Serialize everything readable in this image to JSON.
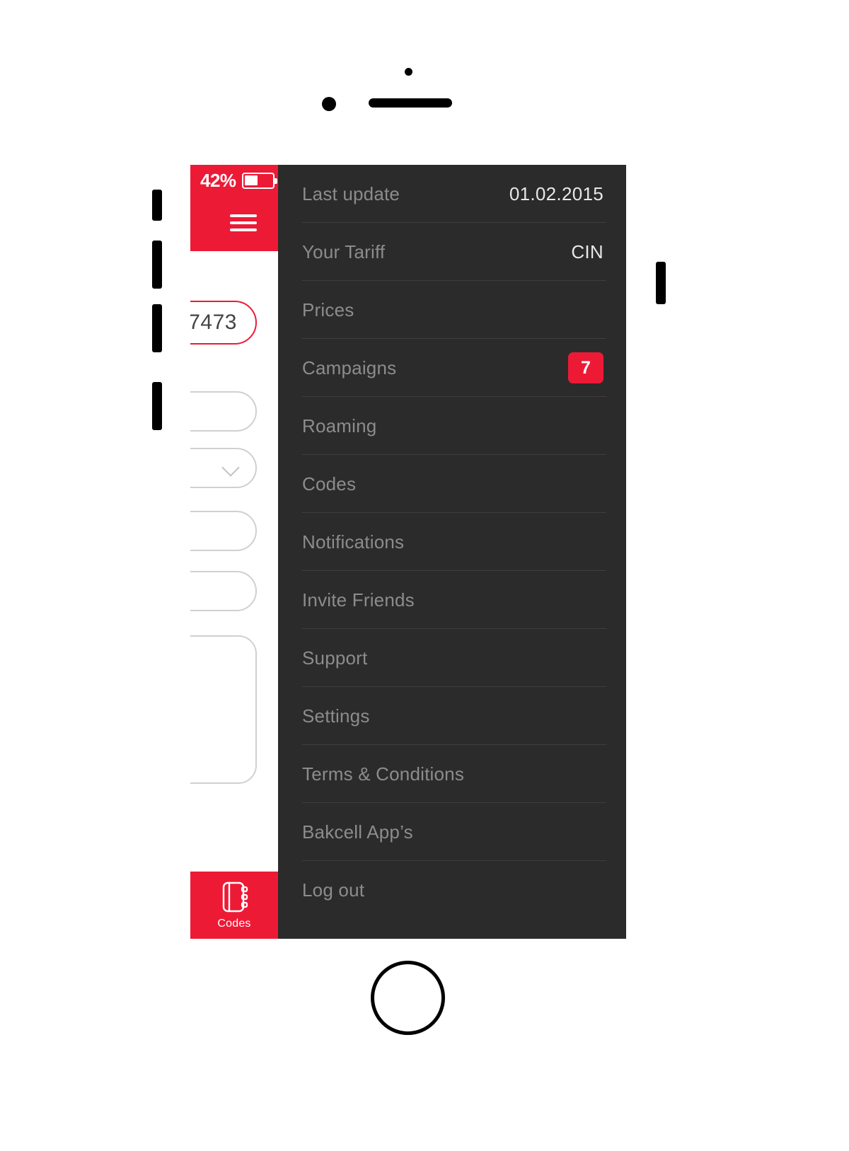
{
  "device": {
    "name": "smartphone-mockup",
    "home_button": "home-button",
    "earpiece": "earpiece-speaker",
    "camera": "front-camera"
  },
  "status_bar": {
    "battery_percent_label": "42%",
    "battery_level": 42,
    "background_color": "#ed1a36"
  },
  "app_background": {
    "menu_button": "hamburger-menu",
    "phone_field_value": "7473",
    "fields": [
      {
        "name": "phone-number-field",
        "type": "text",
        "value": "7473",
        "active": true
      },
      {
        "name": "form-field-1",
        "type": "text",
        "value": ""
      },
      {
        "name": "form-field-2-select",
        "type": "select",
        "value": ""
      },
      {
        "name": "form-field-3",
        "type": "text",
        "value": ""
      },
      {
        "name": "form-field-4",
        "type": "text",
        "value": ""
      },
      {
        "name": "form-textarea",
        "type": "textarea",
        "value": ""
      }
    ],
    "tab_bar": {
      "active_tab": {
        "label": "Codes",
        "icon": "notebook-icon",
        "background_color": "#ed1a36"
      }
    }
  },
  "drawer": {
    "background_color": "#2b2b2b",
    "accent_color": "#ed1a36",
    "label_color": "#8c8c8c",
    "items": [
      {
        "label": "Last update",
        "value": "01.02.2015",
        "badge": null
      },
      {
        "label": "Your Tariff",
        "value": "CIN",
        "badge": null
      },
      {
        "label": "Prices",
        "value": null,
        "badge": null
      },
      {
        "label": "Campaigns",
        "value": null,
        "badge": "7"
      },
      {
        "label": "Roaming",
        "value": null,
        "badge": null
      },
      {
        "label": "Codes",
        "value": null,
        "badge": null
      },
      {
        "label": "Notifications",
        "value": null,
        "badge": null
      },
      {
        "label": "Invite Friends",
        "value": null,
        "badge": null
      },
      {
        "label": "Support",
        "value": null,
        "badge": null
      },
      {
        "label": "Settings",
        "value": null,
        "badge": null
      },
      {
        "label": "Terms & Conditions",
        "value": null,
        "badge": null
      },
      {
        "label": "Bakcell App’s",
        "value": null,
        "badge": null
      },
      {
        "label": "Log out",
        "value": null,
        "badge": null
      }
    ]
  }
}
